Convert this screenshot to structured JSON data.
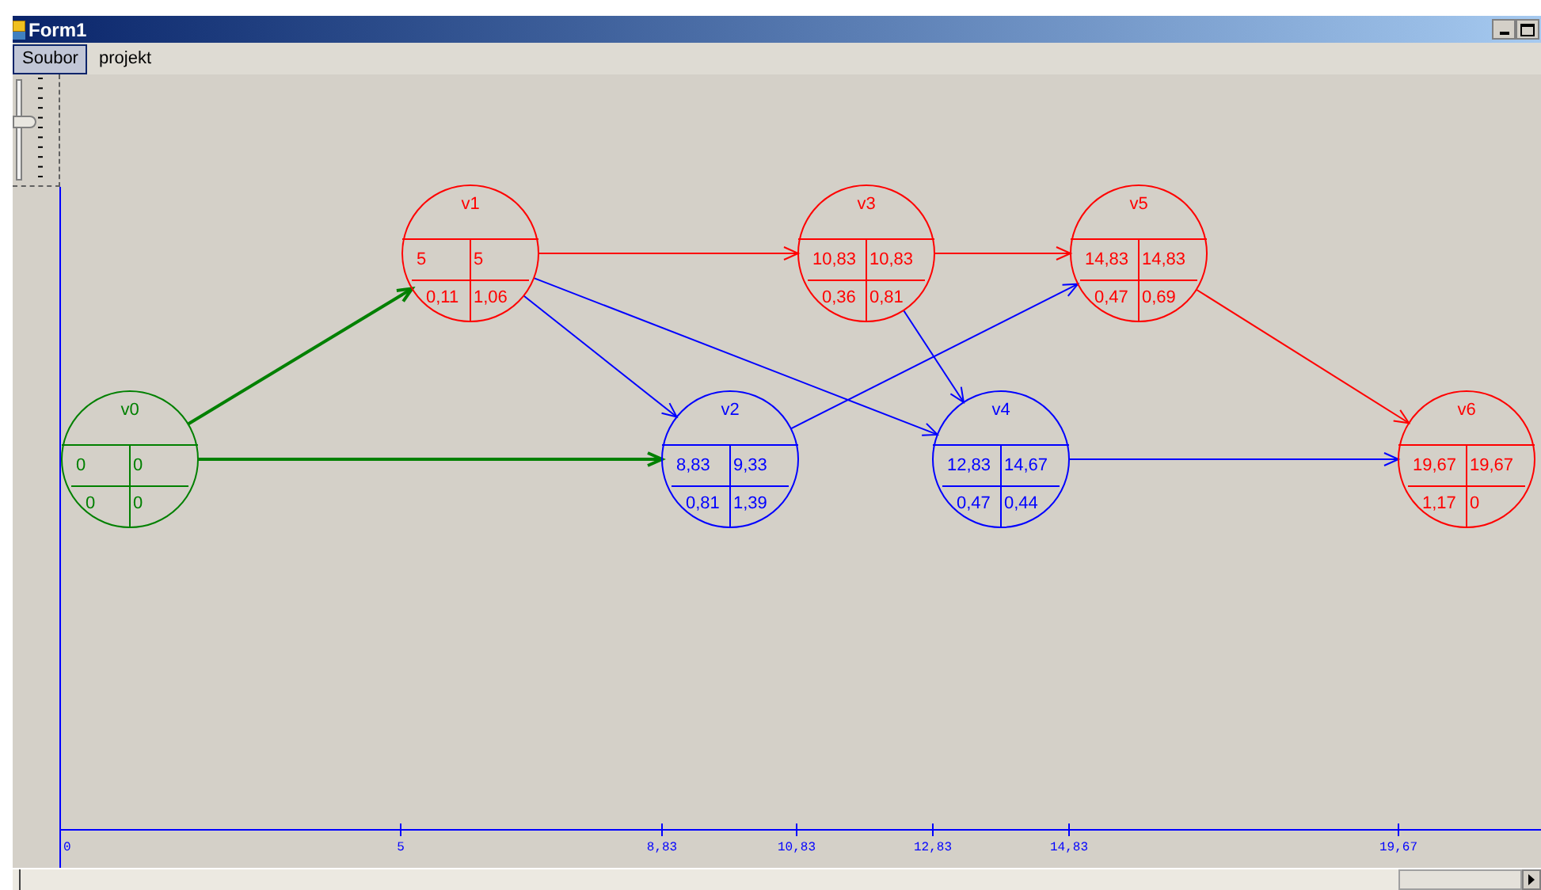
{
  "window": {
    "title": "Form1"
  },
  "menu": [
    {
      "label": "Soubor",
      "selected": true
    },
    {
      "label": "projekt",
      "selected": false
    }
  ],
  "nodes": [
    {
      "name": "v0",
      "color": "#008000",
      "values": [
        "0",
        "0",
        "0",
        "0"
      ]
    },
    {
      "name": "v1",
      "color": "#ff0000",
      "values": [
        "5",
        "5",
        "0,11",
        "1,06"
      ]
    },
    {
      "name": "v2",
      "color": "#0000ff",
      "values": [
        "8,83",
        "9,33",
        "0,81",
        "1,39"
      ]
    },
    {
      "name": "v3",
      "color": "#ff0000",
      "values": [
        "10,83",
        "10,83",
        "0,36",
        "0,81"
      ]
    },
    {
      "name": "v4",
      "color": "#0000ff",
      "values": [
        "12,83",
        "14,67",
        "0,47",
        "0,44"
      ]
    },
    {
      "name": "v5",
      "color": "#ff0000",
      "values": [
        "14,83",
        "14,83",
        "0,47",
        "0,69"
      ]
    },
    {
      "name": "v6",
      "color": "#ff0000",
      "values": [
        "19,67",
        "19,67",
        "1,17",
        "0"
      ]
    }
  ],
  "edges": [
    {
      "color": "#008000",
      "kind": "bold"
    },
    {
      "color": "#008000",
      "kind": "bold"
    },
    {
      "color": "#ff0000",
      "kind": "thin"
    },
    {
      "color": "#0000ff",
      "kind": "thin"
    },
    {
      "color": "#0000ff",
      "kind": "thin"
    },
    {
      "color": "#0000ff",
      "kind": "thin"
    },
    {
      "color": "#ff0000",
      "kind": "thin"
    },
    {
      "color": "#0000ff",
      "kind": "thin"
    },
    {
      "color": "#0000ff",
      "kind": "thin"
    },
    {
      "color": "#ff0000",
      "kind": "thin"
    }
  ],
  "axis": {
    "ticks": [
      "0",
      "5",
      "8,83",
      "10,83",
      "12,83",
      "14,83",
      "19,67"
    ]
  }
}
